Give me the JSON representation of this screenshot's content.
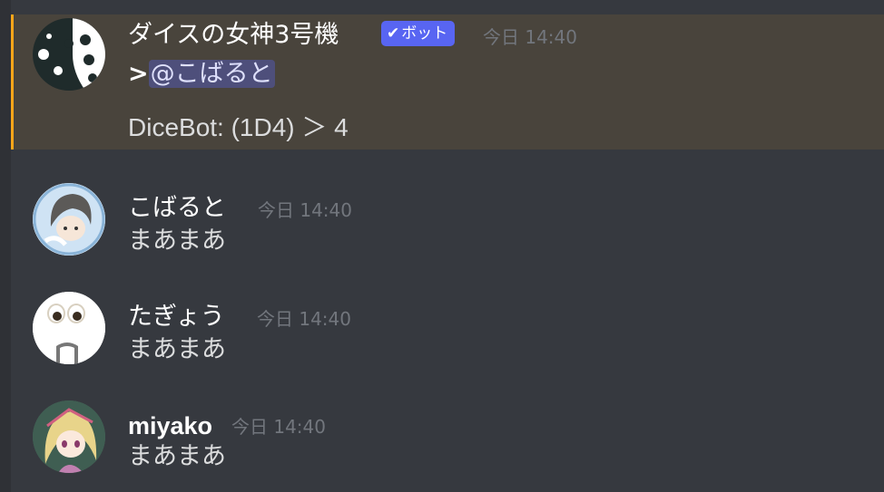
{
  "messages": [
    {
      "author": "ダイスの女神3号機",
      "badge": "ボット",
      "badge_check": "✔",
      "timestamp": "今日 14:40",
      "quote_marker": ">",
      "mention": "@こばると",
      "output": "DiceBot: (1D4) ＞ 4",
      "highlight_color": "#faa61a"
    },
    {
      "author": "こばると",
      "timestamp": "今日 14:40",
      "text": "まあまあ"
    },
    {
      "author": "たぎょう",
      "timestamp": "今日 14:40",
      "text": "まあまあ"
    },
    {
      "author": "miyako",
      "timestamp": "今日 14:40",
      "text": "まあまあ"
    }
  ],
  "colors": {
    "background": "#36393f",
    "highlight_background": "#49443c",
    "mention_background": "#5865f2",
    "badge": "#5865f2",
    "timestamp": "#72767d"
  },
  "icons": {
    "bot_avatar": "dice-face-icon",
    "badge_check": "check-icon"
  }
}
